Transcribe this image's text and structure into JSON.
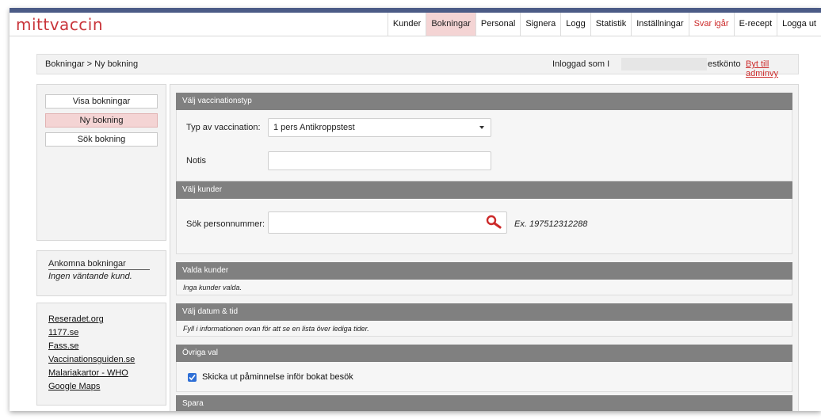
{
  "app": {
    "logo": "mittvaccin"
  },
  "nav": {
    "items": [
      {
        "label": "Kunder",
        "active": false,
        "red": false
      },
      {
        "label": "Bokningar",
        "active": true,
        "red": false
      },
      {
        "label": "Personal",
        "active": false,
        "red": false
      },
      {
        "label": "Signera",
        "active": false,
        "red": false
      },
      {
        "label": "Logg",
        "active": false,
        "red": false
      },
      {
        "label": "Statistik",
        "active": false,
        "red": false
      },
      {
        "label": "Inställningar",
        "active": false,
        "red": false
      },
      {
        "label": "Svar igår",
        "active": false,
        "red": true
      },
      {
        "label": "E-recept",
        "active": false,
        "red": false
      },
      {
        "label": "Logga ut",
        "active": false,
        "red": false
      }
    ]
  },
  "breadcrumb": "Bokningar > Ny bokning",
  "login": {
    "prefix": "Inloggad som I",
    "suffix": "estkönto",
    "switch_link": "Byt till adminvy"
  },
  "sidebar": {
    "buttons": [
      {
        "label": "Visa bokningar",
        "active": false
      },
      {
        "label": "Ny bokning",
        "active": true
      },
      {
        "label": "Sök bokning",
        "active": false
      }
    ],
    "arrivals": {
      "title": "Ankomna bokningar",
      "text": "Ingen väntande kund."
    },
    "links": [
      "Reseradet.org",
      "1177.se",
      "Fass.se",
      "Vaccinationsguiden.se",
      "Malariakartor - WHO",
      "Google Maps"
    ]
  },
  "sections": {
    "vaccination_type": {
      "header": "Välj vaccinationstyp",
      "type_label": "Typ av vaccination:",
      "type_value": "1 pers Antikroppstest",
      "note_label": "Notis",
      "note_value": ""
    },
    "customers": {
      "header": "Välj kunder",
      "search_label": "Sök personnummer:",
      "search_value": "",
      "example": "Ex. 197512312288"
    },
    "selected_customers": {
      "header": "Valda kunder",
      "text": "Inga kunder valda."
    },
    "datetime": {
      "header": "Välj datum & tid",
      "text": "Fyll i informationen ovan för att se en lista över lediga tider."
    },
    "other": {
      "header": "Övriga val",
      "reminder_label": "Skicka ut påminnelse inför bokat besök",
      "reminder_checked": true
    },
    "save": {
      "header": "Spara"
    }
  },
  "colors": {
    "brand_red": "#c9353b",
    "active_pink": "#f4d4d4",
    "section_header": "#808080",
    "checkbox_blue": "#2f6fd6"
  }
}
